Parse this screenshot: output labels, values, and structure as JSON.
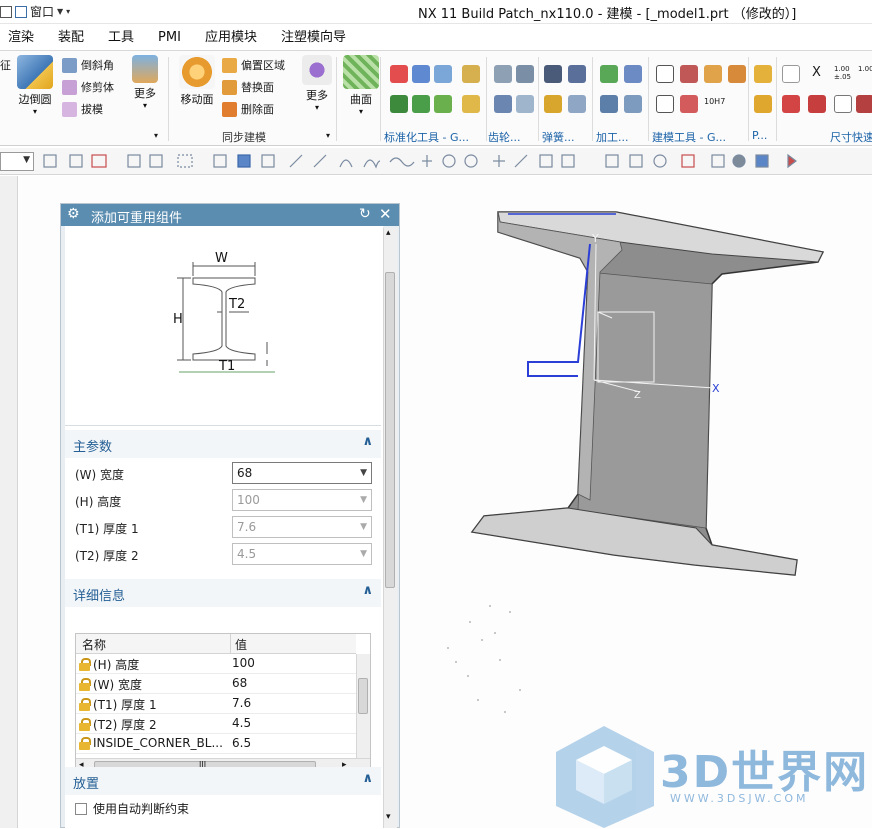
{
  "window": {
    "title": "NX 11  Build Patch_nx110.0 - 建模 - [_model1.prt （修改的）]",
    "window_menu_label": "窗口"
  },
  "tabs": [
    "渲染",
    "装配",
    "工具",
    "PMI",
    "应用模块",
    "注塑模向导"
  ],
  "ribbon": {
    "partial_left_label": "征",
    "edge_blend_label": "边倒圆",
    "chamfer_label": "倒斜角",
    "trim_body_label": "修剪体",
    "draft_label": "拔模",
    "more_label_1": "更多",
    "move_face_label": "移动面",
    "offset_region_label": "偏置区域",
    "replace_face_label": "替换面",
    "delete_face_label": "删除面",
    "more_label_2": "更多",
    "surface_label": "曲面",
    "sync_modeling_group": "同步建模",
    "standard_tools_group": "标准化工具 - G...",
    "gear_group": "齿轮...",
    "spring_group": "弹簧...",
    "machining_group": "加工...",
    "modeling_tools_group": "建模工具 - G...",
    "p_group": "P...",
    "dim_quick_group": "尺寸快速",
    "dim_val_a": "1.00\n±.05",
    "dim_val_b": "1.00",
    "tol_label": "10H7",
    "x_label": "X"
  },
  "dialog": {
    "title": "添加可重用组件",
    "preview_labels": {
      "w": "W",
      "h": "H",
      "t1": "T1",
      "t2": "T2"
    },
    "main_params_title": "主参数",
    "main_params": [
      {
        "label": "(W) 宽度",
        "value": "68",
        "enabled": true
      },
      {
        "label": "(H) 高度",
        "value": "100",
        "enabled": false
      },
      {
        "label": "(T1) 厚度 1",
        "value": "7.6",
        "enabled": false
      },
      {
        "label": "(T2) 厚度 2",
        "value": "4.5",
        "enabled": false
      }
    ],
    "details_title": "详细信息",
    "details_columns": [
      "名称",
      "值"
    ],
    "details_rows": [
      {
        "name": "(H) 高度",
        "value": "100"
      },
      {
        "name": "(W) 宽度",
        "value": "68"
      },
      {
        "name": "(T1) 厚度 1",
        "value": "7.6"
      },
      {
        "name": "(T2) 厚度 2",
        "value": "4.5"
      },
      {
        "name": "INSIDE_CORNER_BL...",
        "value": "6.5"
      }
    ],
    "hscroll_grip": "III",
    "placement_title": "放置",
    "auto_constraint_label": "使用自动判断约束"
  },
  "viewport": {
    "axis_x": "X",
    "axis_y": "Y",
    "axis_z": "Z"
  },
  "watermark": {
    "brand": "3D世界网",
    "url": "WWW.3DSJW.COM"
  },
  "colors": {
    "dialog_header": "#5a8db0",
    "section_title": "#245f95",
    "beam_face": "#8d8d8d",
    "beam_light": "#d9d9d9",
    "selection_blue": "#2b3fd6",
    "watermark": "#8fb8dd"
  }
}
